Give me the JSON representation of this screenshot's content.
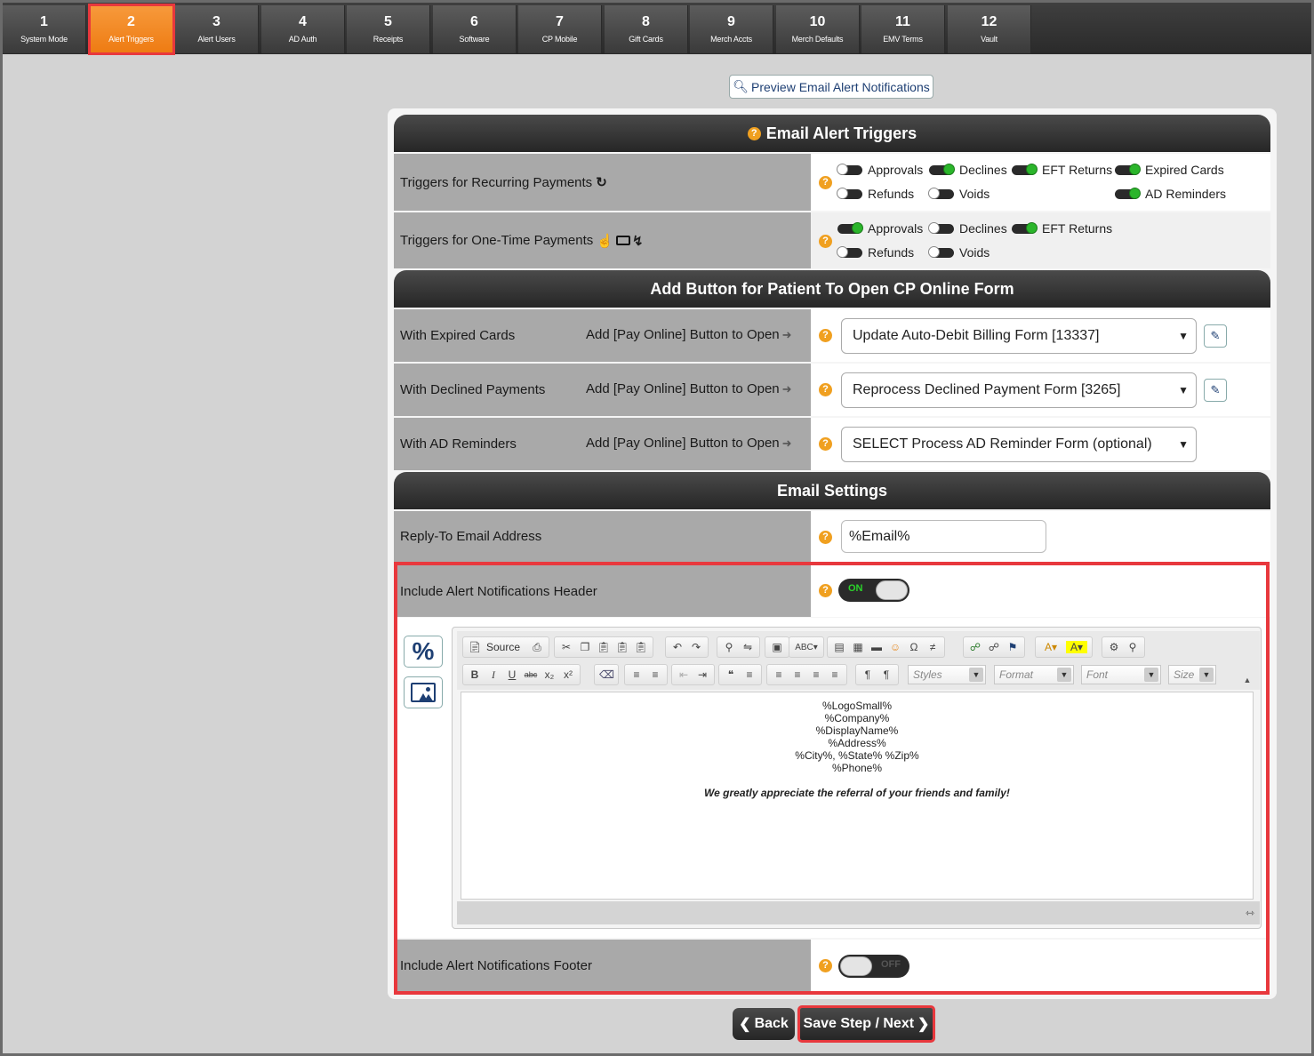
{
  "tabs": [
    {
      "num": "1",
      "label": "System Mode"
    },
    {
      "num": "2",
      "label": "Alert Triggers"
    },
    {
      "num": "3",
      "label": "Alert Users"
    },
    {
      "num": "4",
      "label": "AD Auth"
    },
    {
      "num": "5",
      "label": "Receipts"
    },
    {
      "num": "6",
      "label": "Software"
    },
    {
      "num": "7",
      "label": "CP Mobile"
    },
    {
      "num": "8",
      "label": "Gift Cards"
    },
    {
      "num": "9",
      "label": "Merch Accts"
    },
    {
      "num": "10",
      "label": "Merch Defaults"
    },
    {
      "num": "11",
      "label": "EMV Terms"
    },
    {
      "num": "12",
      "label": "Vault"
    }
  ],
  "active_tab": "2",
  "preview_button": "Preview Email Alert Notifications",
  "section1": {
    "title": "Email Alert Triggers",
    "recurring": {
      "label": "Triggers for Recurring Payments",
      "toggles": [
        {
          "label": "Approvals",
          "on": false
        },
        {
          "label": "Declines",
          "on": true
        },
        {
          "label": "EFT Returns",
          "on": true
        },
        {
          "label": "Expired Cards",
          "on": true
        },
        {
          "label": "Refunds",
          "on": false
        },
        {
          "label": "Voids",
          "on": false
        },
        {
          "label": "AD Reminders",
          "on": true
        }
      ]
    },
    "onetime": {
      "label": "Triggers for One-Time Payments",
      "toggles": [
        {
          "label": "Approvals",
          "on": true
        },
        {
          "label": "Declines",
          "on": false
        },
        {
          "label": "EFT Returns",
          "on": true
        },
        {
          "label": "Refunds",
          "on": false
        },
        {
          "label": "Voids",
          "on": false
        }
      ]
    }
  },
  "section2": {
    "title": "Add Button for Patient To Open CP Online Form",
    "add_text": "Add [Pay Online] Button to Open",
    "rows": [
      {
        "label": "With Expired Cards",
        "value": "Update Auto-Debit Billing Form [13337]"
      },
      {
        "label": "With Declined Payments",
        "value": "Reprocess Declined Payment Form [3265]"
      },
      {
        "label": "With AD Reminders",
        "value": "SELECT Process AD Reminder Form (optional)"
      }
    ]
  },
  "section3": {
    "title": "Email Settings",
    "reply_to_label": "Reply-To Email Address",
    "reply_to_value": "%Email%",
    "header_label": "Include Alert Notifications Header",
    "header_toggle": "ON",
    "footer_label": "Include Alert Notifications Footer",
    "footer_toggle": "OFF"
  },
  "editor": {
    "source_label": "Source",
    "combos": [
      "Styles",
      "Format",
      "Font",
      "Size"
    ],
    "lines": [
      "%LogoSmall%",
      "%Company%",
      "%DisplayName%",
      "%Address%",
      "%City%, %State% %Zip%",
      "%Phone%"
    ],
    "italic_line": "We greatly appreciate the referral of your friends and family!"
  },
  "buttons": {
    "back": "Back",
    "next": "Save Step / Next"
  },
  "colors": {
    "active_tab": "#f28a24",
    "highlight": "#e8383d",
    "toggle_on": "#2bb52b",
    "help": "#f0a020"
  }
}
